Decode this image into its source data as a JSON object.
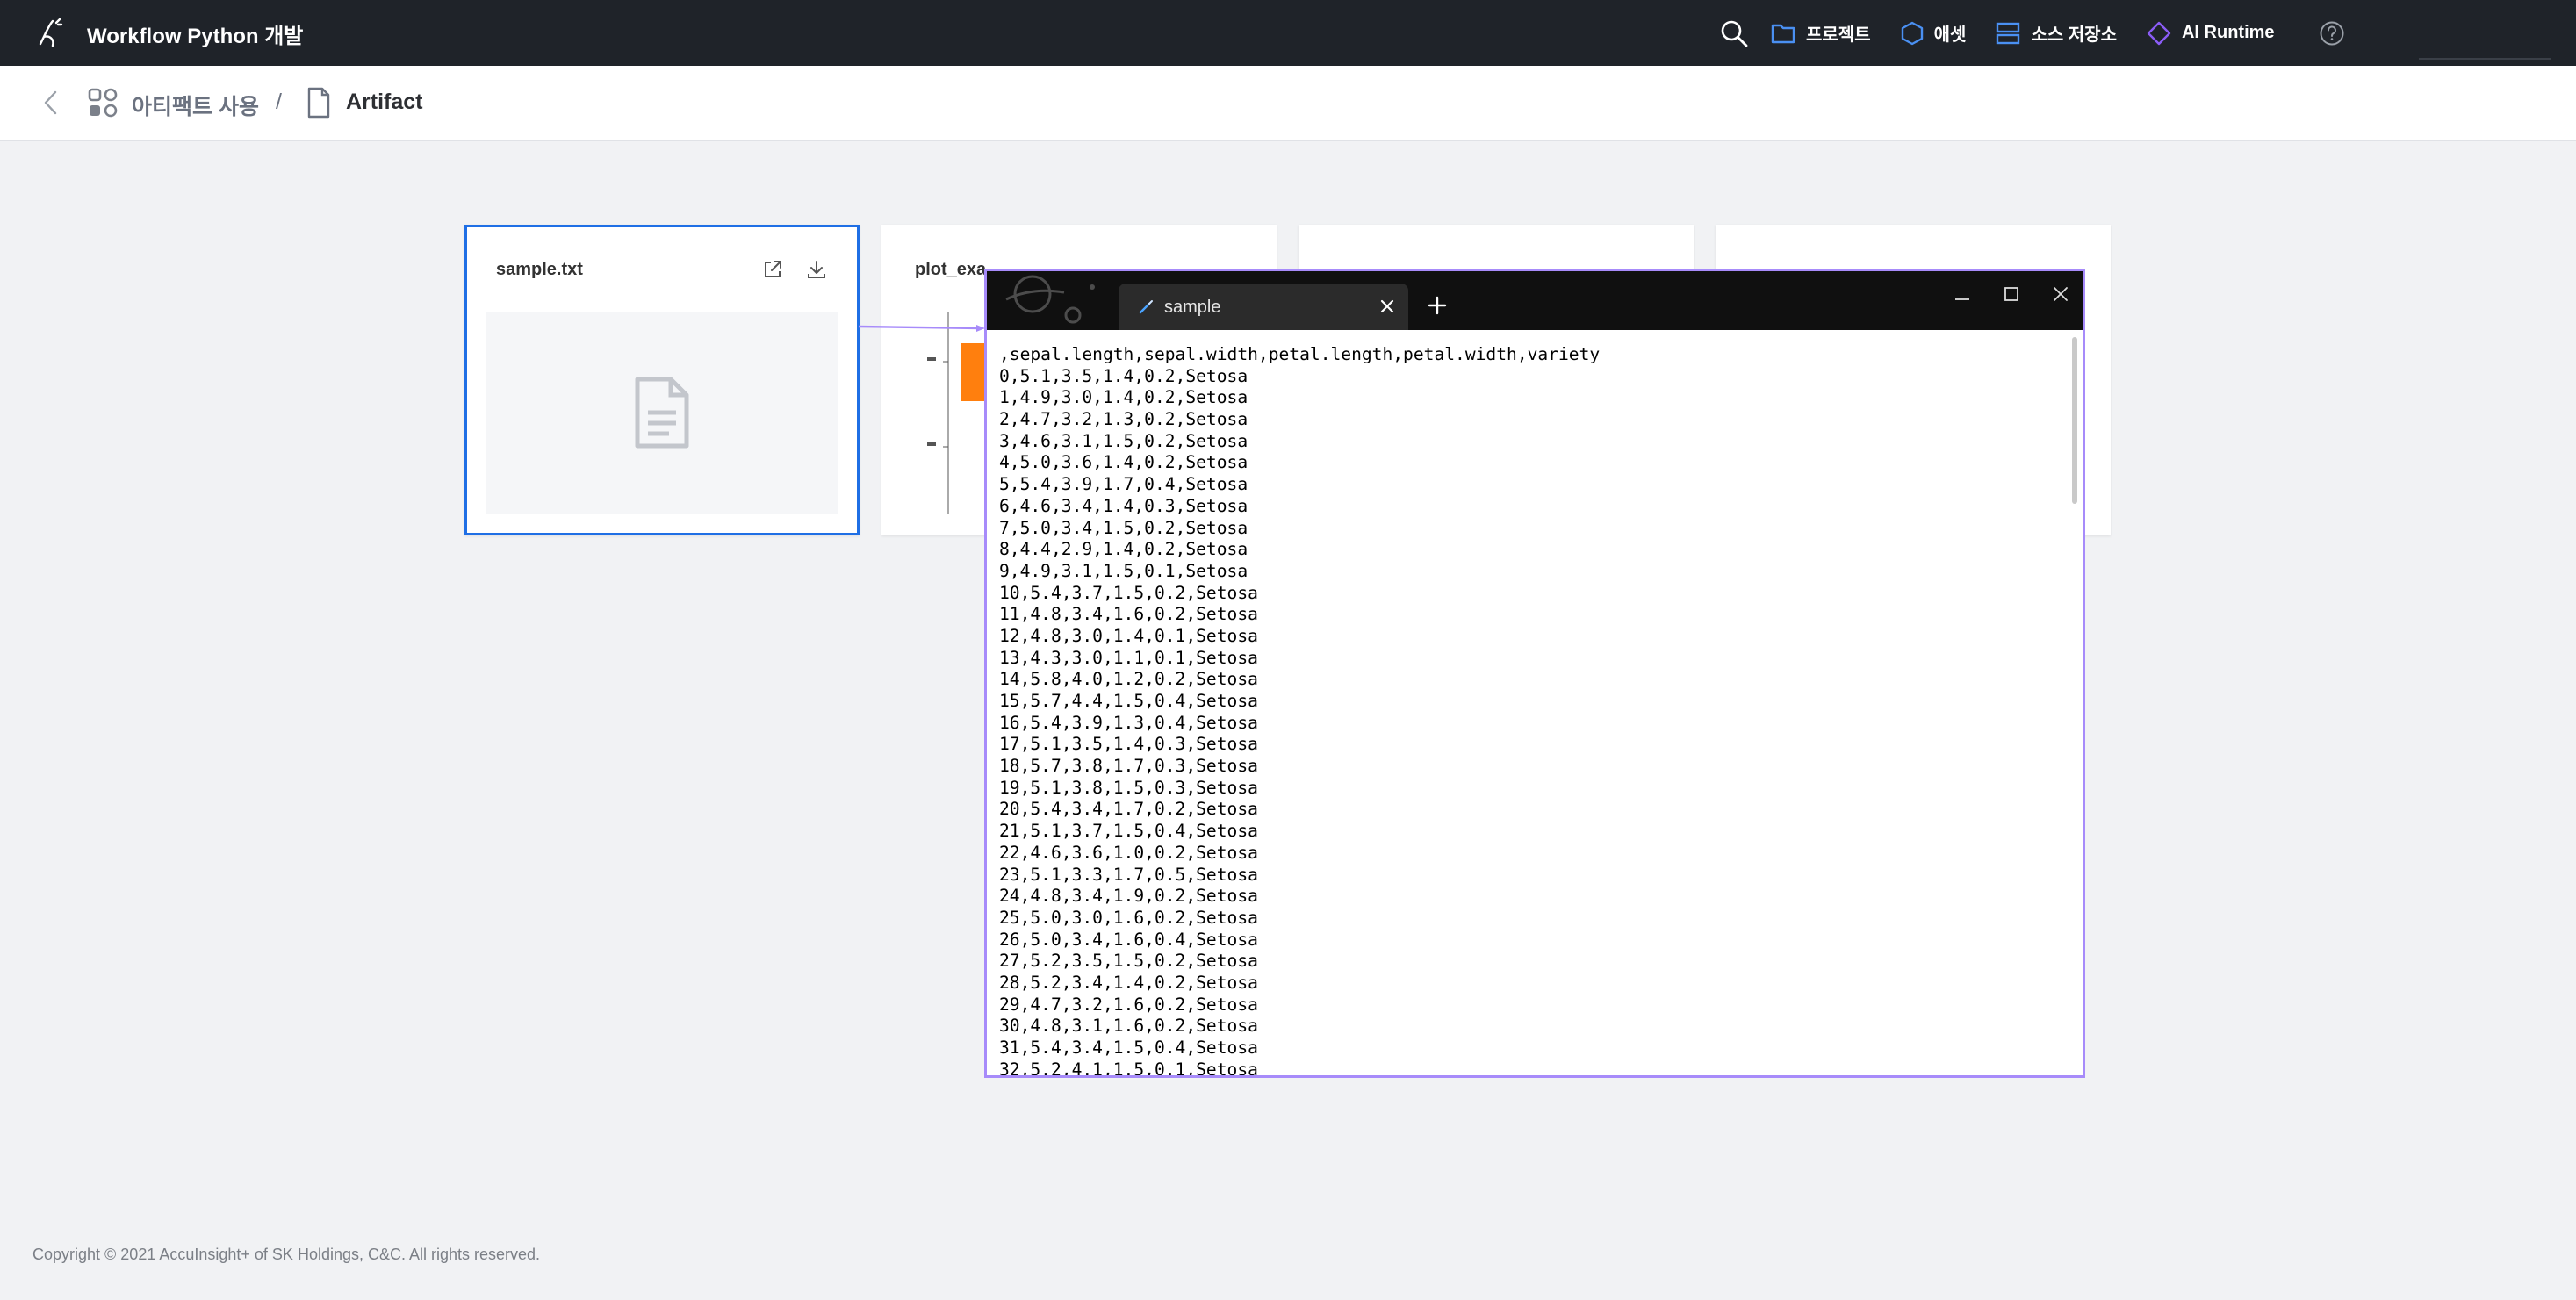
{
  "app": {
    "title": "Workflow Python 개발"
  },
  "nav": {
    "search_icon": "search-icon",
    "items": [
      {
        "label": "프로젝트",
        "icon": "folder-icon",
        "color": "#4a90f2"
      },
      {
        "label": "애셋",
        "icon": "hexagon-icon",
        "color": "#4a90f2"
      },
      {
        "label": "소스 저장소",
        "icon": "storage-icon",
        "color": "#4a90f2"
      },
      {
        "label": "AI Runtime",
        "icon": "diamond-icon",
        "color": "#8b5cf6"
      }
    ],
    "help_icon": "help-icon"
  },
  "breadcrumb": {
    "parent": "아티팩트 사용",
    "separator": "/",
    "current": "Artifact"
  },
  "cards": [
    {
      "title": "sample.txt",
      "selected": true
    },
    {
      "title": "plot_exa"
    },
    {
      "title": ""
    },
    {
      "title": ""
    }
  ],
  "notepad": {
    "tab_label": "sample",
    "lines": [
      ",sepal.length,sepal.width,petal.length,petal.width,variety",
      "0,5.1,3.5,1.4,0.2,Setosa",
      "1,4.9,3.0,1.4,0.2,Setosa",
      "2,4.7,3.2,1.3,0.2,Setosa",
      "3,4.6,3.1,1.5,0.2,Setosa",
      "4,5.0,3.6,1.4,0.2,Setosa",
      "5,5.4,3.9,1.7,0.4,Setosa",
      "6,4.6,3.4,1.4,0.3,Setosa",
      "7,5.0,3.4,1.5,0.2,Setosa",
      "8,4.4,2.9,1.4,0.2,Setosa",
      "9,4.9,3.1,1.5,0.1,Setosa",
      "10,5.4,3.7,1.5,0.2,Setosa",
      "11,4.8,3.4,1.6,0.2,Setosa",
      "12,4.8,3.0,1.4,0.1,Setosa",
      "13,4.3,3.0,1.1,0.1,Setosa",
      "14,5.8,4.0,1.2,0.2,Setosa",
      "15,5.7,4.4,1.5,0.4,Setosa",
      "16,5.4,3.9,1.3,0.4,Setosa",
      "17,5.1,3.5,1.4,0.3,Setosa",
      "18,5.7,3.8,1.7,0.3,Setosa",
      "19,5.1,3.8,1.5,0.3,Setosa",
      "20,5.4,3.4,1.7,0.2,Setosa",
      "21,5.1,3.7,1.5,0.4,Setosa",
      "22,4.6,3.6,1.0,0.2,Setosa",
      "23,5.1,3.3,1.7,0.5,Setosa",
      "24,4.8,3.4,1.9,0.2,Setosa",
      "25,5.0,3.0,1.6,0.2,Setosa",
      "26,5.0,3.4,1.6,0.4,Setosa",
      "27,5.2,3.5,1.5,0.2,Setosa",
      "28,5.2,3.4,1.4,0.2,Setosa",
      "29,4.7,3.2,1.6,0.2,Setosa",
      "30,4.8,3.1,1.6,0.2,Setosa",
      "31,5.4,3.4,1.5,0.4,Setosa",
      "32,5.2,4.1,1.5,0.1,Setosa"
    ]
  },
  "footer": {
    "copyright": "Copyright © 2021 AccuInsight+ of SK Holdings, C&C. All rights reserved."
  },
  "colors": {
    "topbar": "#1f2329",
    "selected_border": "#1f6fe5",
    "window_highlight": "#a78bfa",
    "bar_orange": "#ff7f0e"
  }
}
